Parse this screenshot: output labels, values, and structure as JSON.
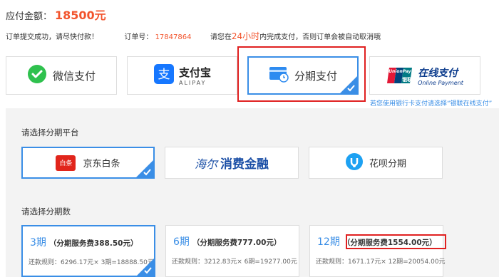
{
  "header": {
    "amount_label": "应付金额：",
    "amount_value": "18500元",
    "order_success": "订单提交成功，请尽快付款！",
    "order_no_label": "订单号：",
    "order_no": "17847864",
    "deadline_prefix": "请您在",
    "deadline_time": "24小时",
    "deadline_suffix": "内完成支付，否则订单会被自动取消哦"
  },
  "payment_methods": [
    {
      "label": "微信支付",
      "icon": "wechat-icon"
    },
    {
      "label": "支付宝",
      "sub": "ALIPAY",
      "icon": "alipay-icon"
    },
    {
      "label": "分期支付",
      "icon": "installment-card-icon",
      "selected": true
    },
    {
      "label": "在线支付",
      "sub": "Online Payment",
      "badge_top": "UnionPay",
      "badge_bottom": "银联",
      "icon": "unionpay-icon"
    }
  ],
  "hint": "若您使用银行卡支付请选择“银联在线支付”",
  "platform_section_title": "请选择分期平台",
  "platforms": [
    {
      "label": "京东白条",
      "logo_text": "白条",
      "icon": "jd-baitiao-icon",
      "selected": true
    },
    {
      "label": "消费金融",
      "logo_text": "海尔",
      "icon": "haier-finance-icon"
    },
    {
      "label": "花呗分期",
      "icon": "huabei-icon"
    }
  ],
  "terms_section_title": "请选择分期数",
  "terms": [
    {
      "period": "3期",
      "fee": "（分期服务费388.50元）",
      "rule": "还款规则：6296.17元× 3期=18888.50元",
      "selected": true
    },
    {
      "period": "6期",
      "fee": "（分期服务费777.00元）",
      "rule": "还款规则：3212.83元× 6期=19277.00元"
    },
    {
      "period": "12期",
      "fee": "（分期服务费1554.00元）",
      "rule": "还款规则：1671.17元× 12期=20054.00元"
    }
  ],
  "colors": {
    "accent": "#3a8ee6",
    "price": "#f2542d",
    "highlight_frame": "#e02020",
    "panel_bg": "#f3f3f3"
  }
}
